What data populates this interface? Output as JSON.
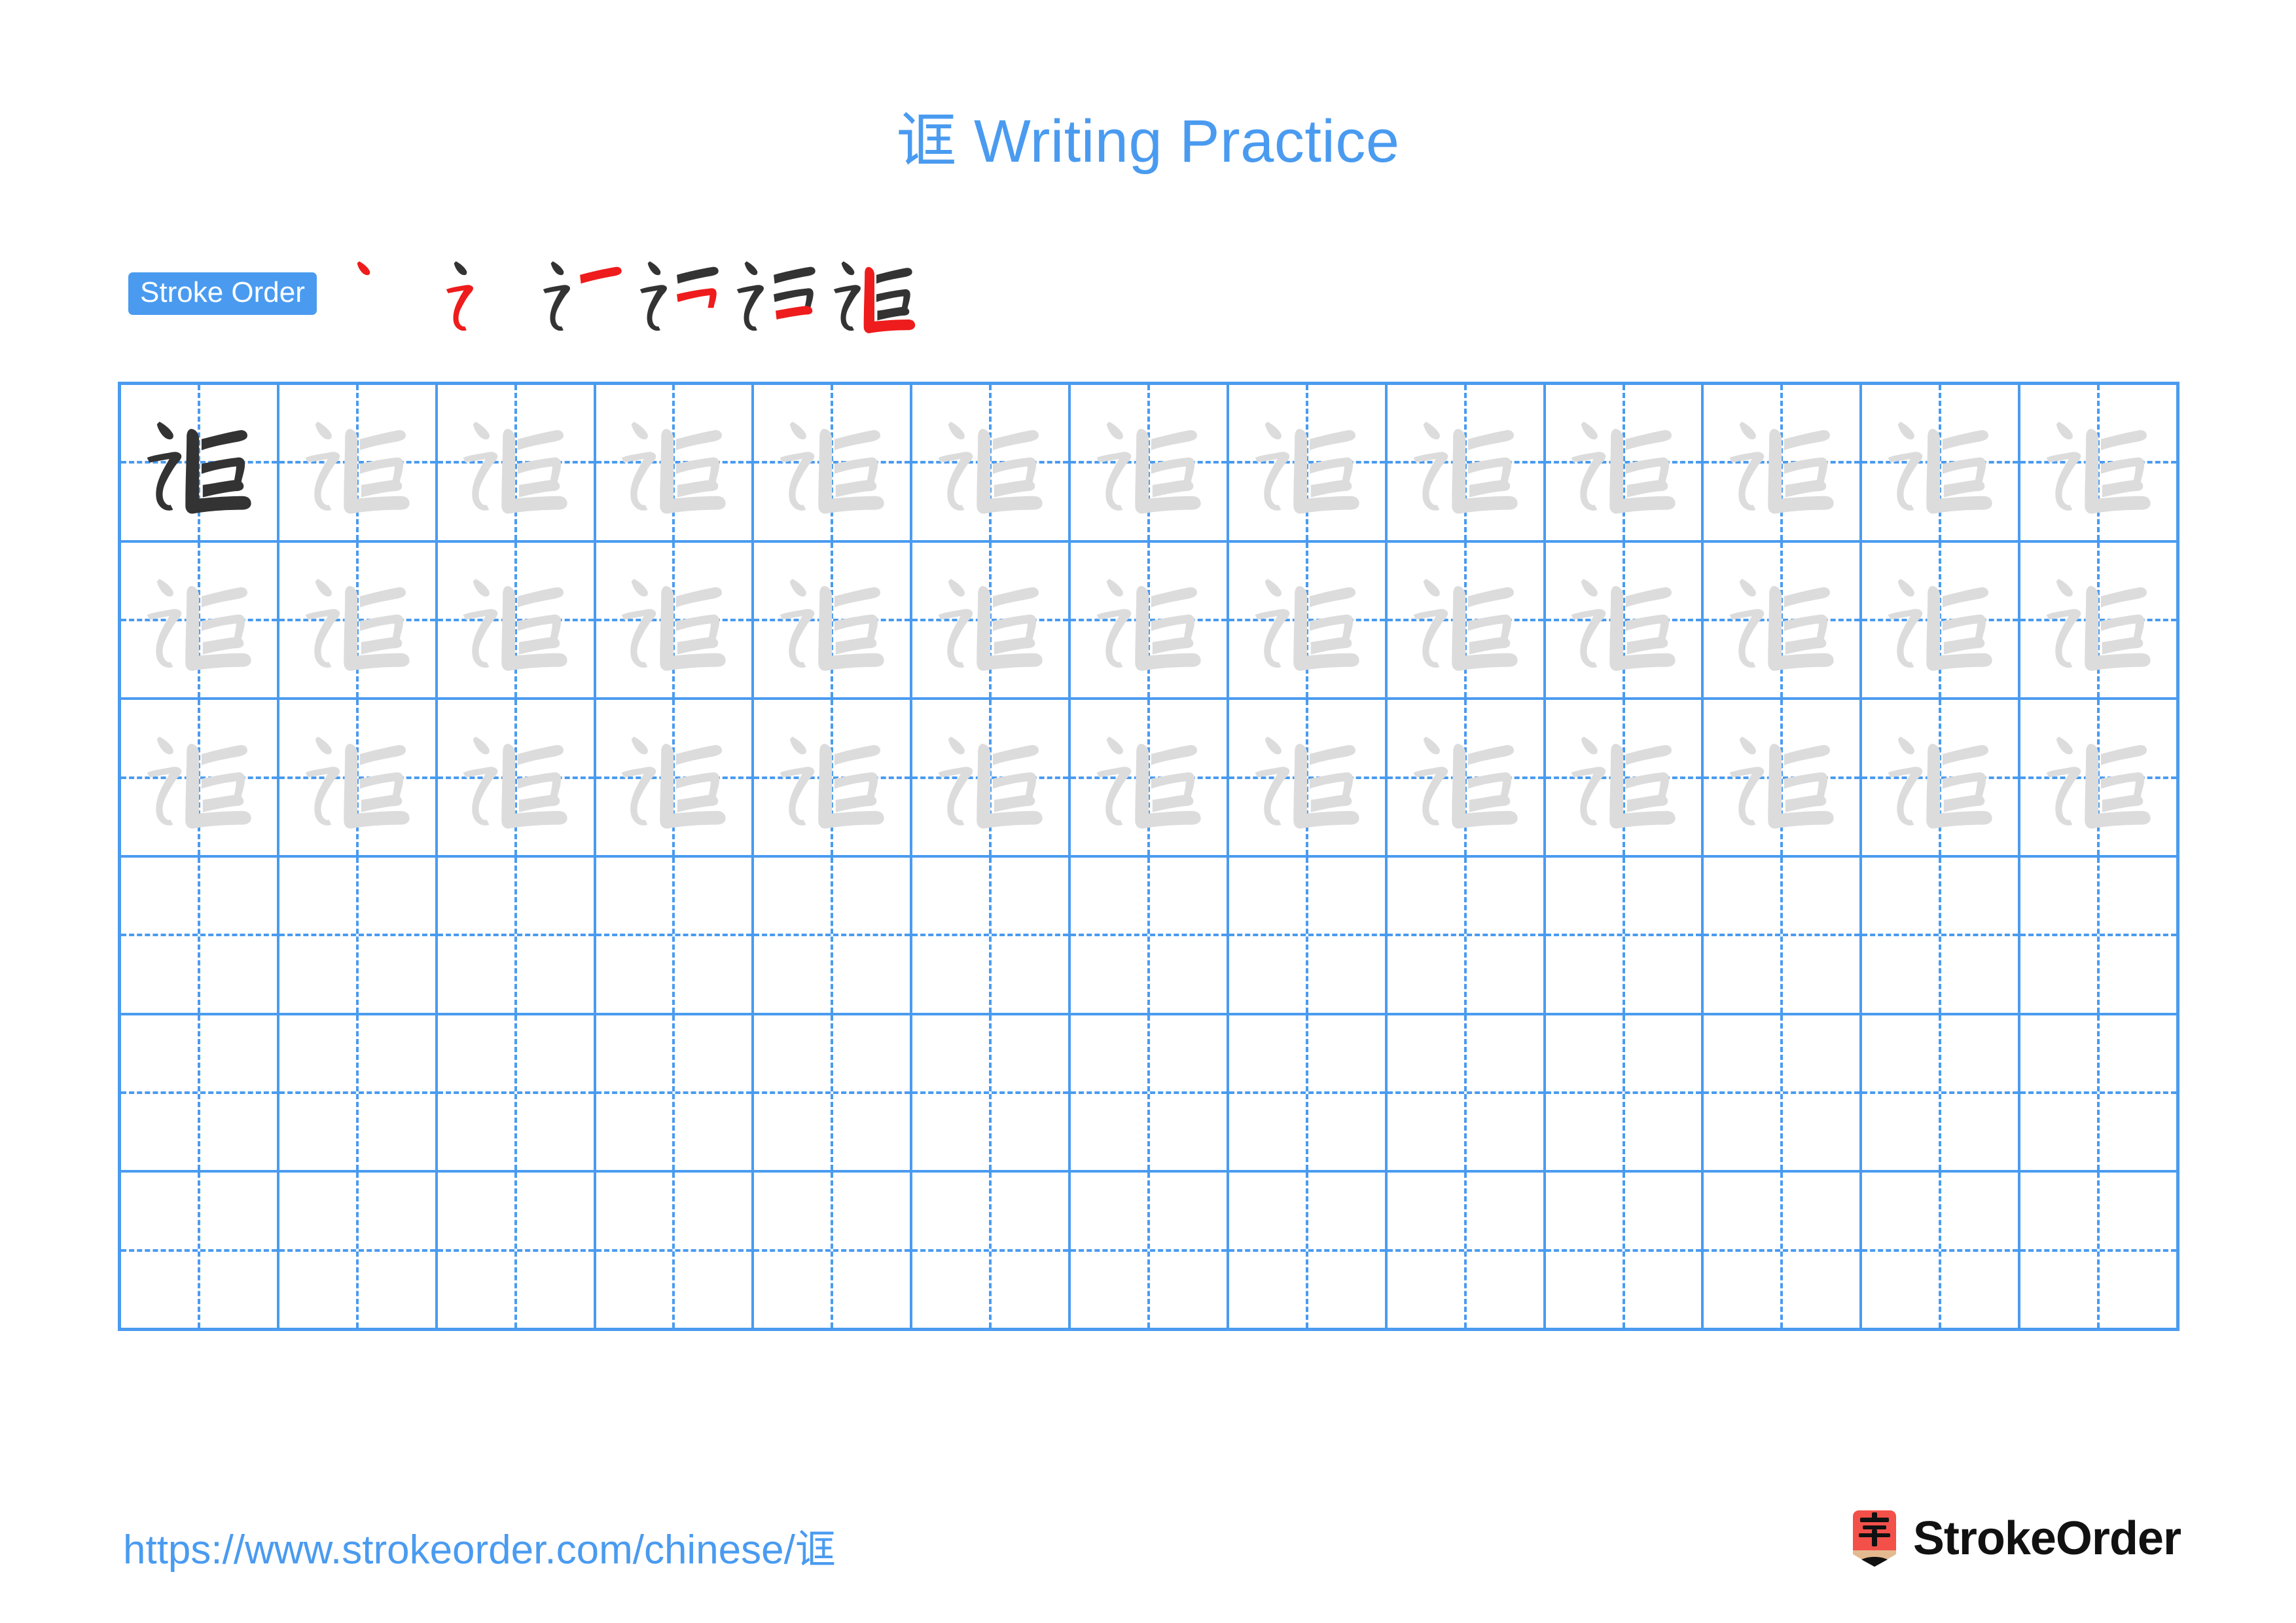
{
  "character": "诓",
  "page": {
    "title": "诓 Writing Practice",
    "background_color": "#ffffff"
  },
  "colors": {
    "accent_blue": "#4a9bf0",
    "grid_line": "#4a9bf0",
    "glyph_dark": "#333333",
    "glyph_light": "#dcdcdc",
    "stroke_new": "#ee1c1c",
    "stroke_done": "#333333",
    "logo_red": "#f4504a",
    "logo_tan": "#e3b98f"
  },
  "stroke_order": {
    "label": "Stroke Order",
    "total_strokes": 6,
    "steps": [
      {
        "index": 1,
        "strokes_shown": 1,
        "new_stroke": "dot"
      },
      {
        "index": 2,
        "strokes_shown": 2,
        "new_stroke": "horizontal-fold-hook"
      },
      {
        "index": 3,
        "strokes_shown": 3,
        "new_stroke": "horizontal"
      },
      {
        "index": 4,
        "strokes_shown": 4,
        "new_stroke": "horizontal-fold"
      },
      {
        "index": 5,
        "strokes_shown": 5,
        "new_stroke": "horizontal"
      },
      {
        "index": 6,
        "strokes_shown": 6,
        "new_stroke": "vertical-fold-horizontal"
      }
    ]
  },
  "practice_grid": {
    "rows": 6,
    "columns": 13,
    "cells": [
      [
        "dark",
        "light",
        "light",
        "light",
        "light",
        "light",
        "light",
        "light",
        "light",
        "light",
        "light",
        "light",
        "light"
      ],
      [
        "light",
        "light",
        "light",
        "light",
        "light",
        "light",
        "light",
        "light",
        "light",
        "light",
        "light",
        "light",
        "light"
      ],
      [
        "light",
        "light",
        "light",
        "light",
        "light",
        "light",
        "light",
        "light",
        "light",
        "light",
        "light",
        "light",
        "light"
      ],
      [
        "empty",
        "empty",
        "empty",
        "empty",
        "empty",
        "empty",
        "empty",
        "empty",
        "empty",
        "empty",
        "empty",
        "empty",
        "empty"
      ],
      [
        "empty",
        "empty",
        "empty",
        "empty",
        "empty",
        "empty",
        "empty",
        "empty",
        "empty",
        "empty",
        "empty",
        "empty",
        "empty"
      ],
      [
        "empty",
        "empty",
        "empty",
        "empty",
        "empty",
        "empty",
        "empty",
        "empty",
        "empty",
        "empty",
        "empty",
        "empty",
        "empty"
      ]
    ]
  },
  "footer": {
    "url": "https://www.strokeorder.com/chinese/诓",
    "brand_name": "StrokeOrder",
    "logo_character": "字"
  }
}
